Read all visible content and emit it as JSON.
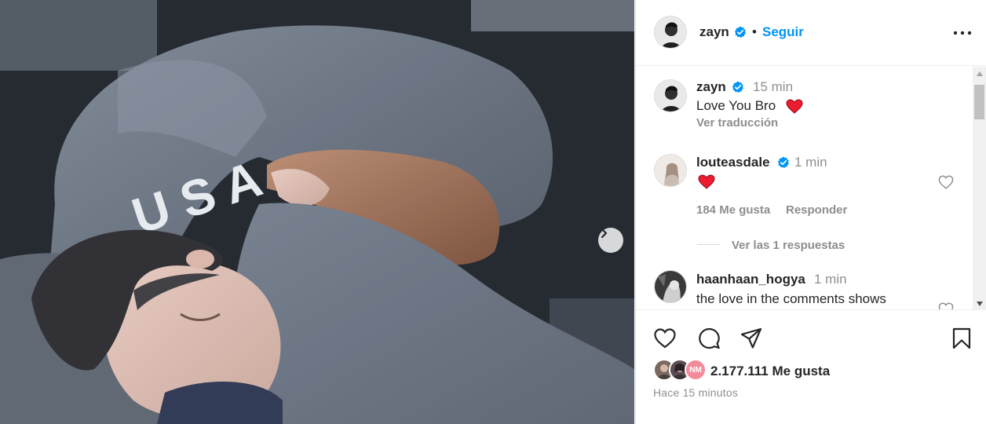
{
  "post": {
    "author": "zayn",
    "follow_label": "Seguir",
    "dot": "•"
  },
  "caption": {
    "username": "zayn",
    "time": "15 min",
    "text": "Love You Bro",
    "translate_label": "Ver traducción"
  },
  "comments": [
    {
      "username": "louteasdale",
      "time": "1 min",
      "text": "",
      "likes_label": "184 Me gusta",
      "reply_label": "Responder",
      "view_replies_label": "Ver las 1 respuestas"
    },
    {
      "username": "haanhaan_hogya",
      "time": "1 min",
      "text": "the love in the comments shows"
    }
  ],
  "footer": {
    "likes_label": "2.177.111 Me gusta",
    "timestamp": "Hace 15 minutos",
    "liker_initials": "NM"
  },
  "icons": {
    "like": "heart-icon",
    "comment": "comment-icon",
    "share": "share-icon",
    "save": "bookmark-icon",
    "more": "more-options-icon",
    "verified": "verified-badge-icon",
    "next": "chevron-right-icon"
  },
  "colors": {
    "accent": "#0095f6",
    "heart_red": "#ed1b30",
    "text": "#262626",
    "muted": "#8e8e8e"
  }
}
